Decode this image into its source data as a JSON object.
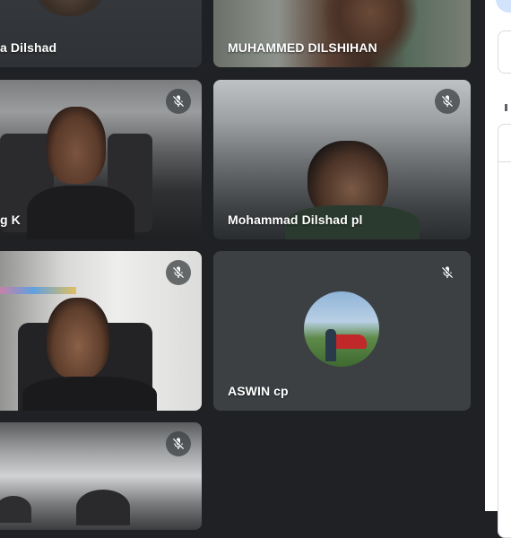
{
  "participants": [
    {
      "name": "a Dilshad",
      "muted": false
    },
    {
      "name": "MUHAMMED DILSHIHAN",
      "muted": false
    },
    {
      "name": "g K",
      "muted": true
    },
    {
      "name": "Mohammad Dilshad pl",
      "muted": true
    },
    {
      "name": "",
      "muted": true
    },
    {
      "name": "ASWIN cp",
      "muted": true
    },
    {
      "name": "",
      "muted": true
    }
  ],
  "colors": {
    "background": "#202124",
    "tile": "#3c4043",
    "panel": "#ffffff"
  },
  "icons": {
    "mute": "mic-off-icon"
  }
}
